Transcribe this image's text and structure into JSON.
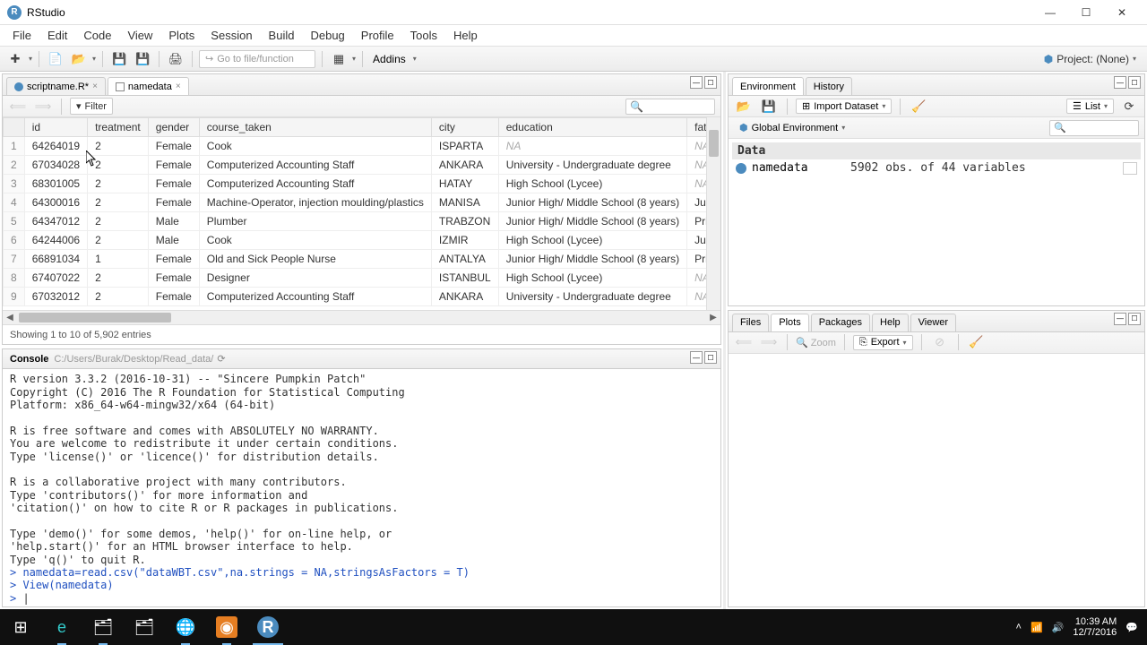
{
  "window": {
    "title": "RStudio"
  },
  "menus": [
    "File",
    "Edit",
    "Code",
    "View",
    "Plots",
    "Session",
    "Build",
    "Debug",
    "Profile",
    "Tools",
    "Help"
  ],
  "toolbar": {
    "goto_placeholder": "Go to file/function",
    "addins": "Addins",
    "project": "Project: (None)"
  },
  "source": {
    "tabs": [
      {
        "label": "scriptname.R*",
        "icon": "r"
      },
      {
        "label": "namedata",
        "icon": "table",
        "active": true
      }
    ],
    "filter_label": "Filter",
    "status": "Showing 1 to 10 of 5,902 entries",
    "columns": [
      "",
      "id",
      "treatment",
      "gender",
      "course_taken",
      "city",
      "education",
      "fathers_ed"
    ],
    "rows": [
      [
        "1",
        "64264019",
        "2",
        "Female",
        "Cook",
        "ISPARTA",
        "NA",
        "NA"
      ],
      [
        "2",
        "67034028",
        "2",
        "Female",
        "Computerized Accounting Staff",
        "ANKARA",
        "University - Undergraduate degree",
        "NA"
      ],
      [
        "3",
        "68301005",
        "2",
        "Female",
        "Computerized Accounting Staff",
        "HATAY",
        "High School (Lycee)",
        "NA"
      ],
      [
        "4",
        "64300016",
        "2",
        "Female",
        "Machine-Operator, injection moulding/plastics",
        "MANISA",
        "Junior High/ Middle School (8 years)",
        "Junior Hi"
      ],
      [
        "5",
        "64347012",
        "2",
        "Male",
        "Plumber",
        "TRABZON",
        "Junior High/ Middle School (8 years)",
        "Primary S"
      ],
      [
        "6",
        "64244006",
        "2",
        "Male",
        "Cook",
        "IZMIR",
        "High School (Lycee)",
        "Junior Hi"
      ],
      [
        "7",
        "66891034",
        "1",
        "Female",
        "Old and Sick People Nurse",
        "ANTALYA",
        "Junior High/ Middle School (8 years)",
        "Primary S"
      ],
      [
        "8",
        "67407022",
        "2",
        "Female",
        "Designer",
        "ISTANBUL",
        "High School (Lycee)",
        "NA"
      ],
      [
        "9",
        "67032012",
        "2",
        "Female",
        "Computerized Accounting Staff",
        "ANKARA",
        "University - Undergraduate degree",
        "NA"
      ]
    ]
  },
  "console": {
    "tab": "Console",
    "path": "C:/Users/Burak/Desktop/Read_data/",
    "text": "R version 3.3.2 (2016-10-31) -- \"Sincere Pumpkin Patch\"\nCopyright (C) 2016 The R Foundation for Statistical Computing\nPlatform: x86_64-w64-mingw32/x64 (64-bit)\n\nR is free software and comes with ABSOLUTELY NO WARRANTY.\nYou are welcome to redistribute it under certain conditions.\nType 'license()' or 'licence()' for distribution details.\n\nR is a collaborative project with many contributors.\nType 'contributors()' for more information and\n'citation()' on how to cite R or R packages in publications.\n\nType 'demo()' for some demos, 'help()' for on-line help, or\n'help.start()' for an HTML browser interface to help.\nType 'q()' to quit R.\n",
    "cmds": [
      "namedata=read.csv(\"dataWBT.csv\",na.strings = NA,stringsAsFactors = T)",
      "View(namedata)"
    ],
    "prompt": "> "
  },
  "env": {
    "tabs": [
      "Environment",
      "History"
    ],
    "import": "Import Dataset",
    "list": "List",
    "scope": "Global Environment",
    "section": "Data",
    "items": [
      {
        "name": "namedata",
        "desc": "5902 obs. of 44 variables"
      }
    ]
  },
  "plots": {
    "tabs": [
      "Files",
      "Plots",
      "Packages",
      "Help",
      "Viewer"
    ],
    "active": "Plots",
    "zoom": "Zoom",
    "export": "Export"
  },
  "taskbar": {
    "time": "10:39 AM",
    "date": "12/7/2016"
  }
}
